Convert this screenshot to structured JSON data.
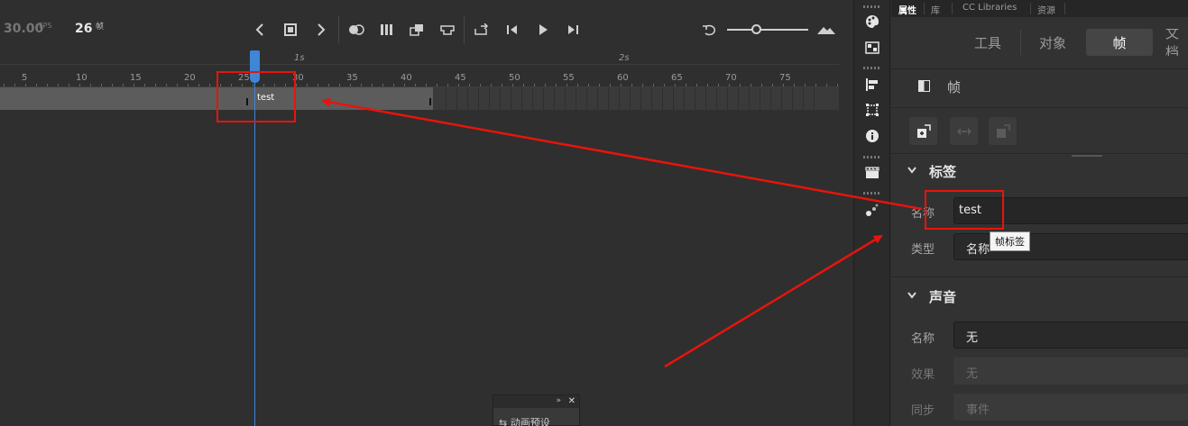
{
  "timeline": {
    "fps_value": "30.00",
    "fps_unit": "FPS",
    "current_frame": "26",
    "frame_unit": "帧",
    "frame_ticks": [
      "5",
      "10",
      "15",
      "20",
      "25",
      "30",
      "35",
      "40",
      "45",
      "50",
      "55",
      "60",
      "65",
      "70",
      "75"
    ],
    "seconds_marks": [
      "1s",
      "2s"
    ],
    "frame_label_text": "test"
  },
  "mini_panel": {
    "expand_glyph": "»",
    "close_glyph": "✕",
    "body_text": "⇆  动画预设"
  },
  "properties": {
    "panel_tabs": [
      "属性",
      "库",
      "CC Libraries",
      "资源"
    ],
    "segments": [
      "工具",
      "对象",
      "帧",
      "文档"
    ],
    "frame_header": "帧",
    "label_section": {
      "title": "标签",
      "name_label": "名称",
      "name_value": "test",
      "type_label": "类型",
      "type_value": "名称"
    },
    "tooltip": "帧标签",
    "sound_section": {
      "title": "声音",
      "name_label": "名称",
      "name_value": "无",
      "effect_label": "效果",
      "effect_value": "无",
      "sync_label": "同步",
      "sync_value": "事件"
    }
  },
  "colors": {
    "playhead": "#3f86d6",
    "annotation_red": "#e8140c",
    "panel_bg": "#323232",
    "timeline_bg": "#2f2f2f"
  }
}
